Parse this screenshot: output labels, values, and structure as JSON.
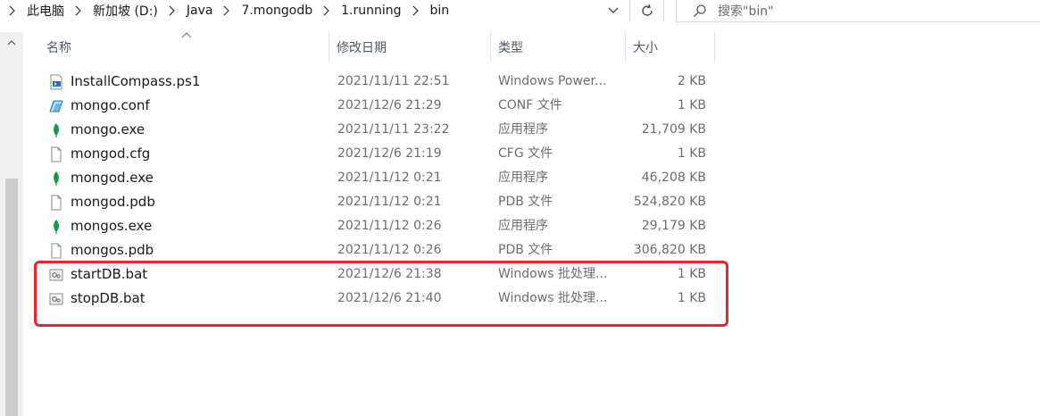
{
  "address_bar": {
    "crumbs": [
      "此电脑",
      "新加坡 (D:)",
      "Java",
      "7.mongodb",
      "1.running",
      "bin"
    ]
  },
  "search": {
    "placeholder": "搜索\"bin\""
  },
  "columns": {
    "name": "名称",
    "modified": "修改日期",
    "type": "类型",
    "size": "大小"
  },
  "files": [
    {
      "name": "InstallCompass.ps1",
      "modified": "2021/11/11 22:51",
      "type": "Windows Power...",
      "size": "2 KB",
      "icon": "powershell-script-icon"
    },
    {
      "name": "mongo.conf",
      "modified": "2021/12/6 21:29",
      "type": "CONF 文件",
      "size": "1 KB",
      "icon": "conf-file-icon"
    },
    {
      "name": "mongo.exe",
      "modified": "2021/11/11 23:22",
      "type": "应用程序",
      "size": "21,709 KB",
      "icon": "mongodb-leaf-icon"
    },
    {
      "name": "mongod.cfg",
      "modified": "2021/12/6 21:19",
      "type": "CFG 文件",
      "size": "1 KB",
      "icon": "blank-file-icon"
    },
    {
      "name": "mongod.exe",
      "modified": "2021/11/12 0:21",
      "type": "应用程序",
      "size": "46,208 KB",
      "icon": "mongodb-leaf-icon"
    },
    {
      "name": "mongod.pdb",
      "modified": "2021/11/12 0:21",
      "type": "PDB 文件",
      "size": "524,820 KB",
      "icon": "blank-file-icon"
    },
    {
      "name": "mongos.exe",
      "modified": "2021/11/12 0:26",
      "type": "应用程序",
      "size": "29,179 KB",
      "icon": "mongodb-leaf-icon"
    },
    {
      "name": "mongos.pdb",
      "modified": "2021/11/12 0:26",
      "type": "PDB 文件",
      "size": "306,820 KB",
      "icon": "blank-file-icon"
    },
    {
      "name": "startDB.bat",
      "modified": "2021/12/6 21:38",
      "type": "Windows 批处理...",
      "size": "1 KB",
      "icon": "batch-file-icon"
    },
    {
      "name": "stopDB.bat",
      "modified": "2021/12/6 21:40",
      "type": "Windows 批处理...",
      "size": "1 KB",
      "icon": "batch-file-icon"
    }
  ],
  "colors": {
    "highlight_border": "#e8262b",
    "mongodb_green": "#13aa52",
    "scrollbar_thumb": "#cdcdcd"
  }
}
